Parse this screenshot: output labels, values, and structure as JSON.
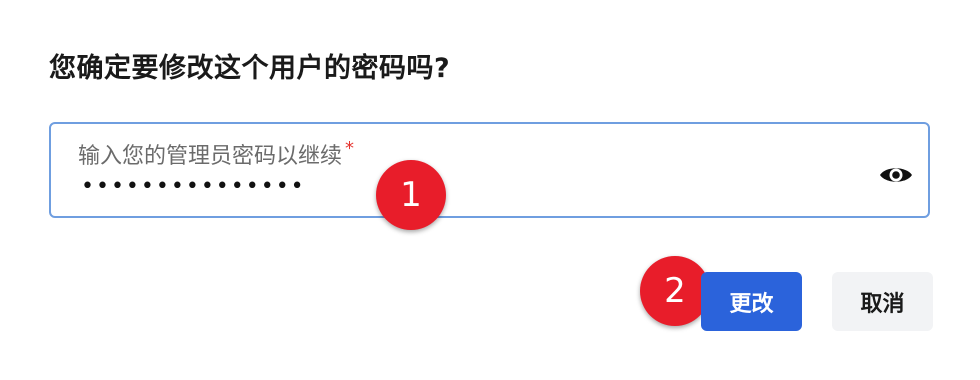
{
  "dialog": {
    "title": "您确定要修改这个用户的密码吗?",
    "password_field": {
      "label": "输入您的管理员密码以继续",
      "required_mark": "*",
      "value_masked": "•••••••••••••••",
      "toggle_icon": "eye-icon"
    },
    "buttons": {
      "confirm_label": "更改",
      "cancel_label": "取消"
    },
    "markers": [
      "1",
      "2"
    ]
  },
  "colors": {
    "accent": "#2b63db",
    "field_border": "#6f9ee0",
    "required": "#e5342f",
    "marker": "#e81d2a"
  }
}
